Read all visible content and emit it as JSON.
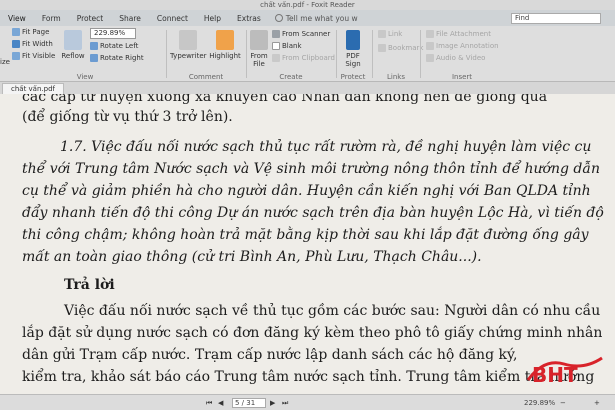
{
  "window": {
    "title": "chất vấn.pdf - Foxit Reader"
  },
  "menu": {
    "tabs": [
      "View",
      "Form",
      "Protect",
      "Share",
      "Connect",
      "Help",
      "Extras"
    ],
    "tell_me": "Tell me what you w",
    "find_placeholder": "Find"
  },
  "ribbon": {
    "fit_page": "Fit Page",
    "fit_width": "Fit Width",
    "fit_visible": "Fit Visible",
    "reflow": "Reflow",
    "zoom_value": "229.89%",
    "rotate_left": "Rotate Left",
    "rotate_right": "Rotate Right",
    "view_group": "View",
    "typewriter": "Typewriter",
    "highlight": "Highlight",
    "comment_group": "Comment",
    "from_file": "From File",
    "from_scanner": "From Scanner",
    "blank": "Blank",
    "from_clipboard": "From Clipboard",
    "create_group": "Create",
    "pdf_sign": "PDF Sign",
    "protect_group": "Protect",
    "link": "Link",
    "bookmark": "Bookmark",
    "links_group": "Links",
    "file_attachment": "File Attachment",
    "image_annotation": "Image Annotation",
    "audio_video": "Audio & Video",
    "insert_group": "Insert",
    "left_fragment": "ize"
  },
  "doc_tab": {
    "label": "chất vấn.pdf"
  },
  "document": {
    "lines": [
      "các cấp từ huyện xuống xã khuyến cáo Nhân dân không nên để giống quá",
      "(để giống từ vụ thứ 3 trở lên).",
      "1.7. Việc đấu nối nước sạch thủ tục rất rườm rà, đề nghị huyện làm việc cụ",
      "thể với Trung tâm Nước sạch và Vệ sinh môi trường nông thôn tỉnh để hướng dẫn",
      "cụ thể và giảm phiền hà cho người dân. Huyện cần kiến nghị với Ban QLDA tỉnh",
      "đẩy nhanh tiến độ thi công Dự án nước sạch trên địa bàn huyện Lộc Hà, vì tiến độ",
      "thi công chậm; không hoàn trả mặt bằng kịp thời sau khi lắp đặt đường ống gây",
      "mất an toàn giao thông (cử tri Bình An, Phù Lưu, Thạch Châu...).",
      "Trả lời",
      "Việc đấu nối nước sạch về thủ tục gồm các bước sau: Người dân có nhu cầu",
      "lắp đặt sử dụng nước sạch có đơn đăng ký kèm theo phô tô giấy chứng minh nhân",
      "dân gửi Trạm cấp nước. Trạm cấp nước lập danh sách các hộ đăng ký,",
      "kiểm tra, khảo sát báo cáo Trung tâm nước sạch tỉnh. Trung tâm kiểm tra hướng"
    ]
  },
  "logo": {
    "text": "BHT"
  },
  "status": {
    "page_value": "5 / 31",
    "zoom_percent": "229.89%"
  },
  "colors": {
    "highlight_icon": "#f0a24a",
    "logo_red": "#d8232a",
    "sign_icon": "#2b6cb0"
  }
}
